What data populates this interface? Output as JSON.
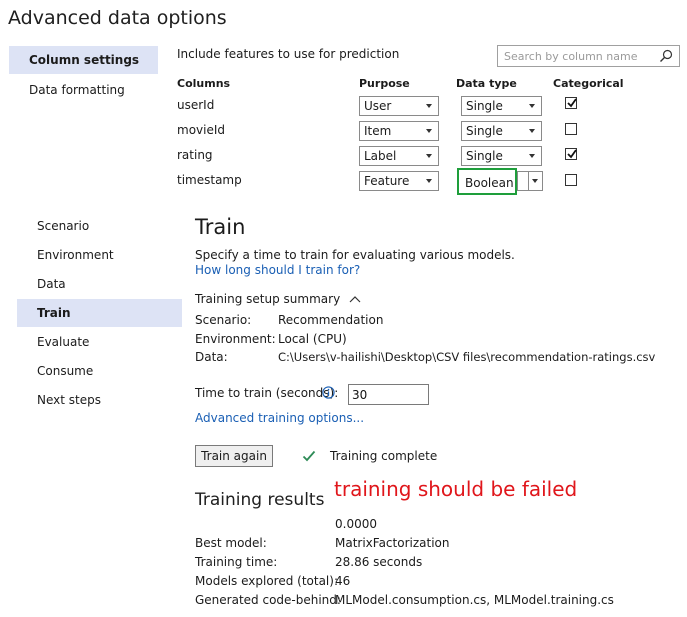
{
  "title": "Advanced data options",
  "top_nav": [
    "Column settings",
    "Data formatting"
  ],
  "columns_section": {
    "instruction": "Include features to use for prediction",
    "search_placeholder": "Search by column name",
    "headers": {
      "columns": "Columns",
      "purpose": "Purpose",
      "data_type": "Data type",
      "categorical": "Categorical"
    },
    "rows": [
      {
        "name": "userId",
        "purpose": "User",
        "data_type": "Single",
        "categorical": true
      },
      {
        "name": "movieId",
        "purpose": "Item",
        "data_type": "Single",
        "categorical": false
      },
      {
        "name": "rating",
        "purpose": "Label",
        "data_type": "Single",
        "categorical": true
      },
      {
        "name": "timestamp",
        "purpose": "Feature",
        "data_type": "Boolean",
        "categorical": false
      }
    ]
  },
  "wizard_nav": [
    "Scenario",
    "Environment",
    "Data",
    "Train",
    "Evaluate",
    "Consume",
    "Next steps"
  ],
  "wizard_selected": "Train",
  "train": {
    "heading": "Train",
    "description": "Specify a time to train for evaluating various models.",
    "help_link": "How long should I train for?",
    "summary_toggle": "Training setup summary",
    "summary": {
      "scenario_key": "Scenario:",
      "scenario_val": "Recommendation",
      "environment_key": "Environment:",
      "environment_val": "Local (CPU)",
      "data_key": "Data:",
      "data_val": "C:\\Users\\v-hailishi\\Desktop\\CSV files\\recommendation-ratings.csv"
    },
    "time_label": "Time to train (seconds):",
    "time_value": "30",
    "advanced_link": "Advanced training options...",
    "train_button": "Train again",
    "status": "Training complete"
  },
  "annotation": "training should be failed",
  "results": {
    "heading": "Training results",
    "metric_value": "0.0000",
    "best_model_key": "Best model:",
    "best_model_val": "MatrixFactorization",
    "training_time_key": "Training time:",
    "training_time_val": "28.86 seconds",
    "models_key": "Models explored (total):",
    "models_val": "46",
    "codebehind_key": "Generated code-behind:",
    "codebehind_val": "MLModel.consumption.cs, MLModel.training.cs"
  },
  "colors": {
    "accent": "#1a5fb4",
    "selection": "#dde3f5",
    "highlight_border": "#1e9e3b",
    "annotation": "#e0161b",
    "success": "#2e8b57"
  },
  "icons": [
    "search-icon",
    "info-icon",
    "chevron-up-icon",
    "checkmark-icon",
    "dropdown-arrow-icon"
  ]
}
